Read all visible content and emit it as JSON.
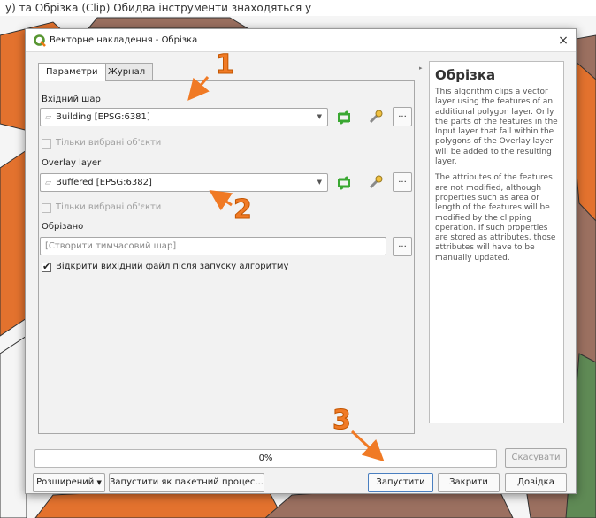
{
  "top_caption": "у) та Обрізка (Clip) Обидва інструменти знаходяться у",
  "dialog": {
    "title": "Векторне накладення - Обрізка",
    "close_glyph": "×",
    "tabs": [
      "Параметри",
      "Журнал"
    ],
    "params": {
      "input_label": "Вхідний шар",
      "input_value": "Building [EPSG:6381]",
      "input_selected_only": "Тільки вибрані об'єкти",
      "overlay_label": "Overlay layer",
      "overlay_value": "Buffered [EPSG:6382]",
      "overlay_selected_only": "Тільки вибрані об'єкти",
      "output_label": "Обрізано",
      "output_placeholder": "[Створити тимчасовий шар]",
      "open_output_label": "Відкрити вихідний файл після запуску алгоритму",
      "open_output_checked": true,
      "dots": "..."
    },
    "help": {
      "title": "Обрізка",
      "paragraphs": [
        "This algorithm clips a vector layer using the features of an additional polygon layer. Only the parts of the features in the Input layer that fall within the polygons of the Overlay layer will be added to the resulting layer.",
        "The attributes of the features are not modified, although properties such as area or length of the features will be modified by the clipping operation. If such properties are stored as attributes, those attributes will have to be manually updated."
      ]
    },
    "progress": {
      "value": 0,
      "text": "0%"
    },
    "buttons": {
      "cancel": "Скасувати",
      "advanced": "Розширений",
      "batch": "Запустити як пакетний процес...",
      "run": "Запустити",
      "close": "Закрити",
      "help": "Довідка"
    }
  },
  "annotations": {
    "one": "1",
    "two": "2",
    "three": "3"
  },
  "colors": {
    "accent_orange": "#f07a25",
    "map_brown": "#9b7060",
    "map_green": "#5f8a55",
    "map_orange": "#e07030"
  }
}
